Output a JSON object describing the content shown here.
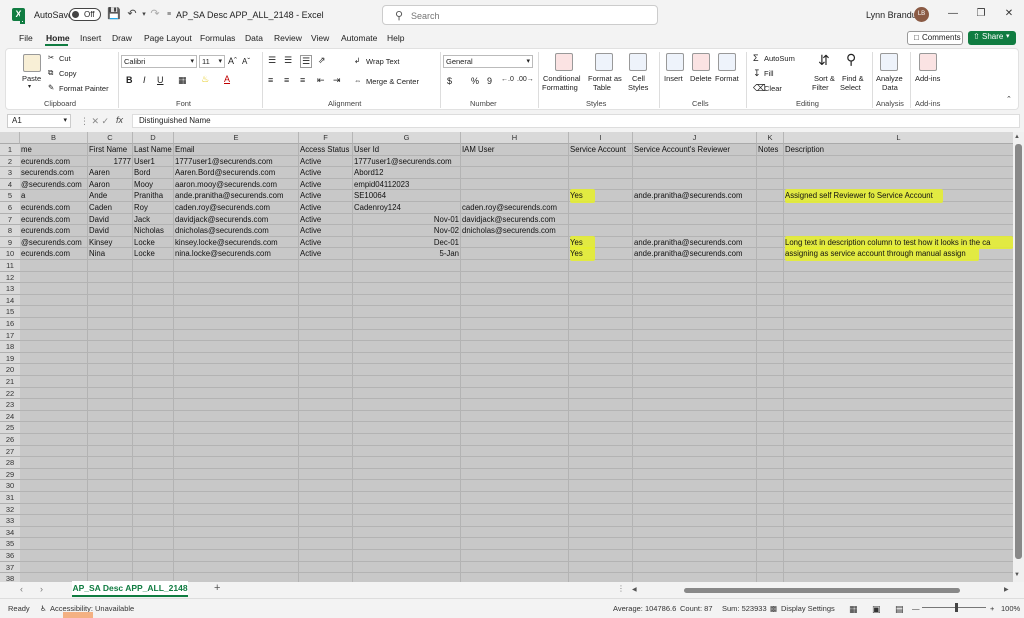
{
  "titlebar": {
    "autosave_label": "AutoSave",
    "autosave_state": "Off",
    "doc_title": "AP_SA Desc APP_ALL_2148  -  Excel",
    "search_placeholder": "Search",
    "user_name": "Lynn Brandus",
    "user_initials": "LB"
  },
  "menu": {
    "tabs": [
      "File",
      "Home",
      "Insert",
      "Draw",
      "Page Layout",
      "Formulas",
      "Data",
      "Review",
      "View",
      "Automate",
      "Help"
    ],
    "active": "Home",
    "comments_label": "Comments",
    "share_label": "Share"
  },
  "ribbon": {
    "clipboard": {
      "paste": "Paste",
      "cut": "Cut",
      "copy": "Copy",
      "format_painter": "Format Painter",
      "label": "Clipboard"
    },
    "font": {
      "name": "Calibri",
      "size": "11",
      "label": "Font"
    },
    "alignment": {
      "wrap_text": "Wrap Text",
      "merge_center": "Merge & Center",
      "label": "Alignment"
    },
    "number": {
      "format": "General",
      "label": "Number"
    },
    "styles": {
      "conditional": "Conditional",
      "formatting": "Formatting",
      "format_as": "Format as",
      "table": "Table",
      "cell": "Cell",
      "cell_styles": "Styles",
      "label": "Styles"
    },
    "cells": {
      "insert": "Insert",
      "delete": "Delete",
      "format": "Format",
      "label": "Cells"
    },
    "editing": {
      "autosum": "AutoSum",
      "fill": "Fill",
      "clear": "Clear",
      "sort_filter_1": "Sort &",
      "sort_filter_2": "Filter",
      "find_select_1": "Find &",
      "find_select_2": "Select",
      "label": "Editing"
    },
    "analysis": {
      "analyze_1": "Analyze",
      "analyze_2": "Data",
      "label": "Analysis"
    },
    "addins": {
      "addins_label": "Add-ins",
      "label": "Add-ins"
    }
  },
  "formula_bar": {
    "name_box": "A1",
    "fx": "fx",
    "content": "Distinguished Name"
  },
  "columns": [
    "B",
    "C",
    "D",
    "E",
    "F",
    "G",
    "H",
    "I",
    "J",
    "K",
    "L"
  ],
  "rows": {
    "header": [
      "me",
      "First Name",
      "Last Name",
      "Email",
      "Access Status",
      "User Id",
      "IAM User",
      "Service Account",
      "Service Account's Reviewer",
      "Notes",
      "Description"
    ],
    "data": [
      [
        "ecurends.com",
        "1777",
        "User1",
        "1777user1@securends.com",
        "Active",
        "1777user1@securends.com",
        "",
        "",
        "",
        "",
        ""
      ],
      [
        "securends.com",
        "Aaren",
        "Bord",
        "Aaren.Bord@securends.com",
        "Active",
        "Abord12",
        "",
        "",
        "",
        "",
        ""
      ],
      [
        "@securends.com",
        "Aaron",
        "Mooy",
        "aaron.mooy@securends.com",
        "Active",
        "empid04112023",
        "",
        "",
        "",
        "",
        ""
      ],
      [
        "a",
        "Ande",
        "Pranitha",
        "ande.pranitha@securends.com",
        "Active",
        "SE10064",
        "",
        "Yes",
        "ande.pranitha@securends.com",
        "",
        "Assigned self Reviewer fo Service Account"
      ],
      [
        "ecurends.com",
        "Caden",
        "Roy",
        "caden.roy@securends.com",
        "Active",
        "Cadenroy124",
        "caden.roy@securends.com",
        "",
        "",
        "",
        ""
      ],
      [
        "ecurends.com",
        "David",
        "Jack",
        "davidjack@securends.com",
        "Active",
        "Nov-01",
        "davidjack@securends.com",
        "",
        "",
        "",
        ""
      ],
      [
        "ecurends.com",
        "David",
        "Nicholas",
        "dnicholas@securends.com",
        "Active",
        "Nov-02",
        "dnicholas@securends.com",
        "",
        "",
        "",
        ""
      ],
      [
        "@securends.com",
        "Kinsey",
        "Locke",
        "kinsey.locke@securends.com",
        "Active",
        "Dec-01",
        "",
        "Yes",
        "ande.pranitha@securends.com",
        "",
        "Long text in description column to test how it looks in the ca"
      ],
      [
        "ecurends.com",
        "Nina",
        "Locke",
        "nina.locke@securends.com",
        "Active",
        "5-Jan",
        "",
        "Yes",
        "ande.pranitha@securends.com",
        "",
        "assigning as service account through manual assign"
      ]
    ]
  },
  "row_numbers": [
    "1",
    "2",
    "3",
    "4",
    "5",
    "6",
    "7",
    "8",
    "9",
    "10",
    "11",
    "12",
    "13",
    "14",
    "15",
    "16",
    "17",
    "18",
    "19",
    "20",
    "21",
    "22",
    "23",
    "24",
    "25",
    "26",
    "27",
    "28",
    "29",
    "30",
    "31",
    "32",
    "33",
    "34",
    "35",
    "36",
    "37",
    "38"
  ],
  "sheet": {
    "tab_name": "AP_SA Desc APP_ALL_2148"
  },
  "status": {
    "ready": "Ready",
    "accessibility": "Accessibility: Unavailable",
    "average": "Average: 104786.6",
    "count": "Count: 87",
    "sum": "Sum: 523933",
    "display_settings": "Display Settings",
    "zoom": "100%"
  },
  "colors": {
    "excel_green": "#107c41",
    "highlight": "#e6f02a"
  }
}
